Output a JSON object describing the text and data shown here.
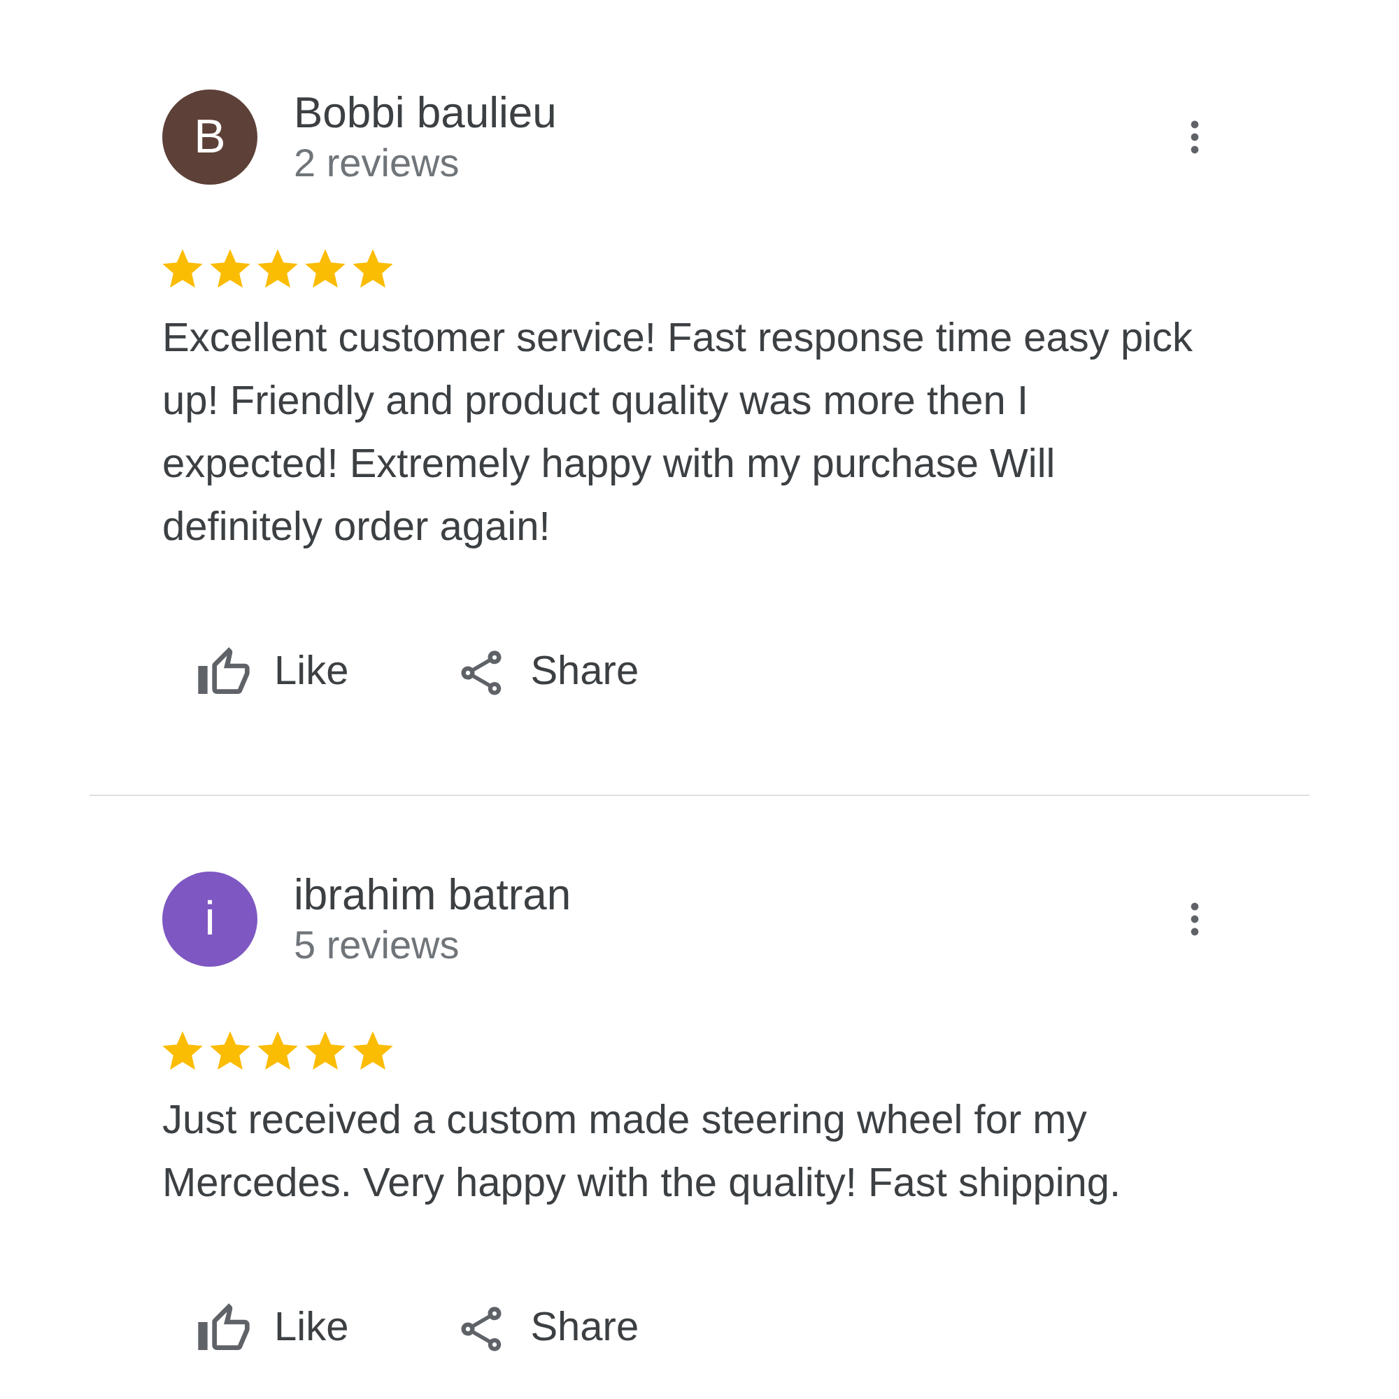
{
  "reviews": [
    {
      "author": {
        "initial": "B",
        "name": "Bobbi baulieu",
        "color": "#5d4037"
      },
      "review_count": "2 reviews",
      "stars": 5,
      "text": "Excellent customer service! Fast response time easy pick up! Friendly and product quality was more then I expected! Extremely happy with my purchase Will definitely order again!",
      "actions": [
        {
          "kind": "like",
          "label": "Like"
        },
        {
          "kind": "share",
          "label": "Share"
        }
      ]
    },
    {
      "author": {
        "initial": "i",
        "name": "ibrahim batran",
        "color": "#7e57c2"
      },
      "review_count": "5 reviews",
      "stars": 5,
      "text": "Just received a custom made steering wheel for my Mercedes. Very happy with the quality! Fast shipping.",
      "actions": [
        {
          "kind": "like",
          "label": "Like"
        },
        {
          "kind": "share",
          "label": "Share"
        }
      ]
    }
  ]
}
